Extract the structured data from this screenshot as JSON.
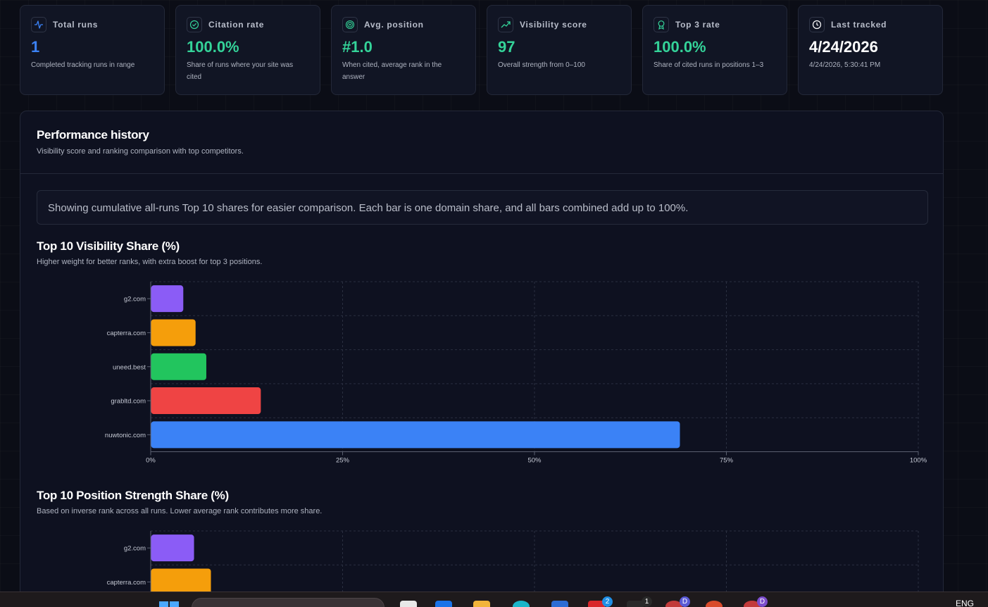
{
  "cards": [
    {
      "label": "Total runs",
      "value": "1",
      "desc": "Completed tracking runs in range",
      "icon": "activity-icon",
      "color": "#3b82f6"
    },
    {
      "label": "Citation rate",
      "value": "100.0%",
      "desc": "Share of runs where your site was cited",
      "icon": "check-circle-icon",
      "color": "#34d399"
    },
    {
      "label": "Avg. position",
      "value": "#1.0",
      "desc": "When cited, average rank in the answer",
      "icon": "target-icon",
      "color": "#34d399"
    },
    {
      "label": "Visibility score",
      "value": "97",
      "desc": "Overall strength from 0–100",
      "icon": "trending-up-icon",
      "color": "#34d399"
    },
    {
      "label": "Top 3 rate",
      "value": "100.0%",
      "desc": "Share of cited runs in positions 1–3",
      "icon": "award-icon",
      "color": "#34d399"
    },
    {
      "label": "Last tracked",
      "value": "4/24/2026",
      "desc": "4/24/2026, 5:30:41 PM",
      "icon": "clock-icon",
      "color": "#ffffff"
    }
  ],
  "panel": {
    "title": "Performance history",
    "subtitle": "Visibility score and ranking comparison with top competitors.",
    "notice": "Showing cumulative all-runs Top 10 shares for easier comparison. Each bar is one domain share, and all bars combined add up to 100%."
  },
  "chart_data": [
    {
      "type": "bar",
      "orientation": "horizontal",
      "title": "Top 10 Visibility Share (%)",
      "subtitle": "Higher weight for better ranks, with extra boost for top 3 positions.",
      "categories": [
        "g2.com",
        "capterra.com",
        "uneed.best",
        "grabltd.com",
        "nuwtonic.com"
      ],
      "values": [
        4.2,
        5.8,
        7.2,
        14.3,
        68.9
      ],
      "colors": [
        "#8b5cf6",
        "#f59e0b",
        "#22c55e",
        "#ef4444",
        "#3b82f6"
      ],
      "xlim": [
        0,
        100
      ],
      "xticks": [
        "0%",
        "25%",
        "50%",
        "75%",
        "100%"
      ],
      "grid": true
    },
    {
      "type": "bar",
      "orientation": "horizontal",
      "title": "Top 10 Position Strength Share (%)",
      "subtitle": "Based on inverse rank across all runs. Lower average rank contributes more share.",
      "categories": [
        "g2.com",
        "capterra.com"
      ],
      "values": [
        5.6,
        7.8
      ],
      "colors": [
        "#8b5cf6",
        "#f59e0b"
      ],
      "xlim": [
        0,
        100
      ],
      "grid": true
    }
  ],
  "taskbar": {
    "language": "ENG",
    "badges": [
      "2",
      "1",
      "D",
      "D"
    ]
  }
}
